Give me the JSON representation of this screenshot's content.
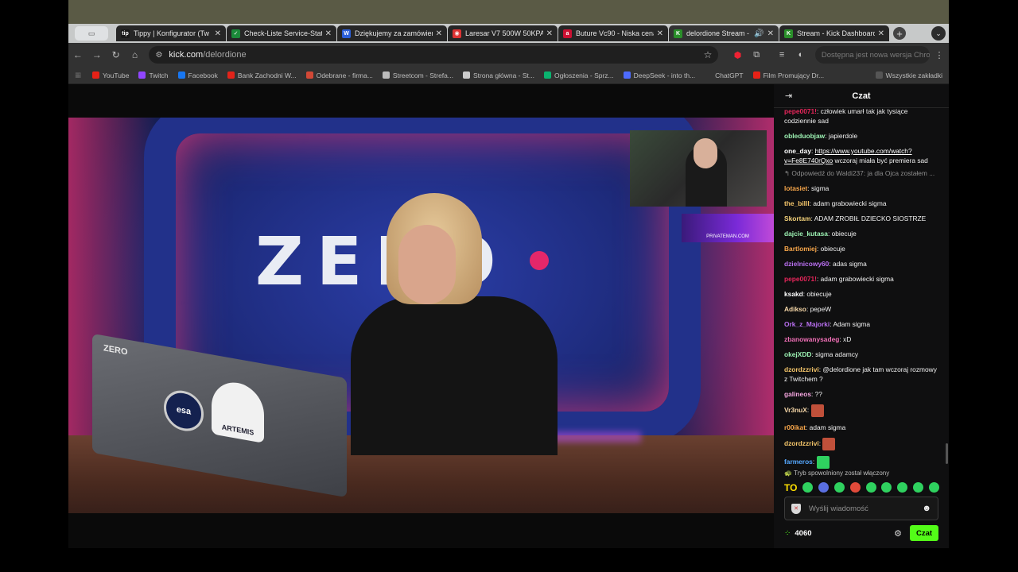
{
  "tabs": [
    {
      "title": "Tippy | Konfigurator (Tw",
      "fav_text": "tip",
      "color": "#1a1a1a"
    },
    {
      "title": "Check-Liste Service-Stat",
      "fav_text": "✓",
      "color": "#1b8a3a"
    },
    {
      "title": "Dziękujemy za zamówien",
      "fav_text": "W",
      "color": "#2b5fd9"
    },
    {
      "title": "Laresar V7 500W 50KPA",
      "fav_text": "◉",
      "color": "#d33"
    },
    {
      "title": "Buture Vc90 - Niska cena",
      "fav_text": "a",
      "color": "#c13"
    },
    {
      "title": "delordione Stream -",
      "fav_text": "K",
      "color": "#2a8f2a"
    },
    {
      "title": "Stream - Kick Dashboard",
      "fav_text": "K",
      "color": "#2a8f2a"
    }
  ],
  "address": {
    "host": "kick.com",
    "path": "/delordione"
  },
  "update_text": "Dostępna jest nowa wersja Chrome",
  "bookmarks": [
    {
      "label": "YouTube",
      "color": "#e62117"
    },
    {
      "label": "Twitch",
      "color": "#9146ff"
    },
    {
      "label": "Facebook",
      "color": "#1877f2"
    },
    {
      "label": "Bank Zachodni W...",
      "color": "#e2231a"
    },
    {
      "label": "Odebrane - firma...",
      "color": "#d14836"
    },
    {
      "label": "Streetcom - Strefa...",
      "color": "#bbbbbb"
    },
    {
      "label": "Strona główna - St...",
      "color": "#cccccc"
    },
    {
      "label": "Ogłoszenia - Sprz...",
      "color": "#0ab36f"
    },
    {
      "label": "DeepSeek - into th...",
      "color": "#4d6bfe"
    },
    {
      "label": "ChatGPT",
      "color": "#323232"
    },
    {
      "label": "Film Promujący Dr...",
      "color": "#e62117"
    }
  ],
  "bookmarks_all": "Wszystkie zakładki",
  "stream": {
    "logo": "ZERO",
    "laptop_brand": "ZERO",
    "esa": "esa",
    "artemis": "ARTEMIS",
    "banner": "PRIVATEMAN.COM"
  },
  "chat": {
    "title": "Czat",
    "messages": [
      {
        "user": "pepe0071!",
        "color": "#e8265b",
        "text": "człowiek umarł tak jak tysiące codziennie sad"
      },
      {
        "user": "obleduobjaw",
        "color": "#9cf2b3",
        "text": "japierdole"
      },
      {
        "user": "one_day",
        "color": "#ffffff",
        "link": "https://www.youtube.com/watch?v=Fe8E740rQxo",
        "text": "wczoraj miała być premiera sad"
      },
      {
        "reply": "Odpowiedź do Waldi237: ja dla Ojca zostałem ..."
      },
      {
        "user": "lotasiet",
        "color": "#f7a64a",
        "text": "sigma"
      },
      {
        "user": "the_billl",
        "color": "#f6c76b",
        "text": "adam grabowiecki sigma"
      },
      {
        "user": "Skortam",
        "color": "#f4d27a",
        "text": "ADAM ZROBIŁ DZIECKO SIOSTRZE"
      },
      {
        "user": "dajcie_kutasa",
        "color": "#9cf2b3",
        "text": "obiecuje"
      },
      {
        "user": "Bartlomiej",
        "color": "#f7a64a",
        "text": "obiecuje"
      },
      {
        "user": "dzielnicowy60",
        "color": "#b96ff0",
        "text": "adas sigma"
      },
      {
        "user": "pepe0071!",
        "color": "#e8265b",
        "text": "adam grabowiecki sigma"
      },
      {
        "user": "ksakd",
        "color": "#ffffff",
        "text": "obiecuje"
      },
      {
        "user": "Adikso",
        "color": "#f6d7a8",
        "text": "pepeW"
      },
      {
        "user": "Ork_z_Majorki",
        "color": "#b96ff0",
        "text": "Adam sigma"
      },
      {
        "user": "zbanowanysadeg",
        "color": "#f06fb6",
        "text": "xD"
      },
      {
        "user": "okejXDD",
        "color": "#9cf2b3",
        "text": "sigma adamcy"
      },
      {
        "user": "dzordzzrivi",
        "color": "#f6c76b",
        "text": "@delordione jak tam wczoraj rozmowy z Twitchem ?"
      },
      {
        "user": "galineos",
        "color": "#f6a6e0",
        "text": "??"
      },
      {
        "user": "Vr3nuX",
        "color": "#f6d7a8",
        "emote": "#c0503a"
      },
      {
        "user": "r00ikat",
        "color": "#f7a64a",
        "text": "adam sigma"
      },
      {
        "user": "dzordzzrivi",
        "color": "#f6c76b",
        "emote": "#c0503a"
      },
      {
        "user": "farmeros",
        "color": "#55a8ff",
        "emote": "#2fd15f"
      }
    ],
    "slow_mode": "Tryb spowolniony został włączony",
    "emote_text": "TO",
    "input_placeholder": "Wyślij wiadomość",
    "points": "4060",
    "send_label": "Czat"
  },
  "accent_color": "#53fc18"
}
